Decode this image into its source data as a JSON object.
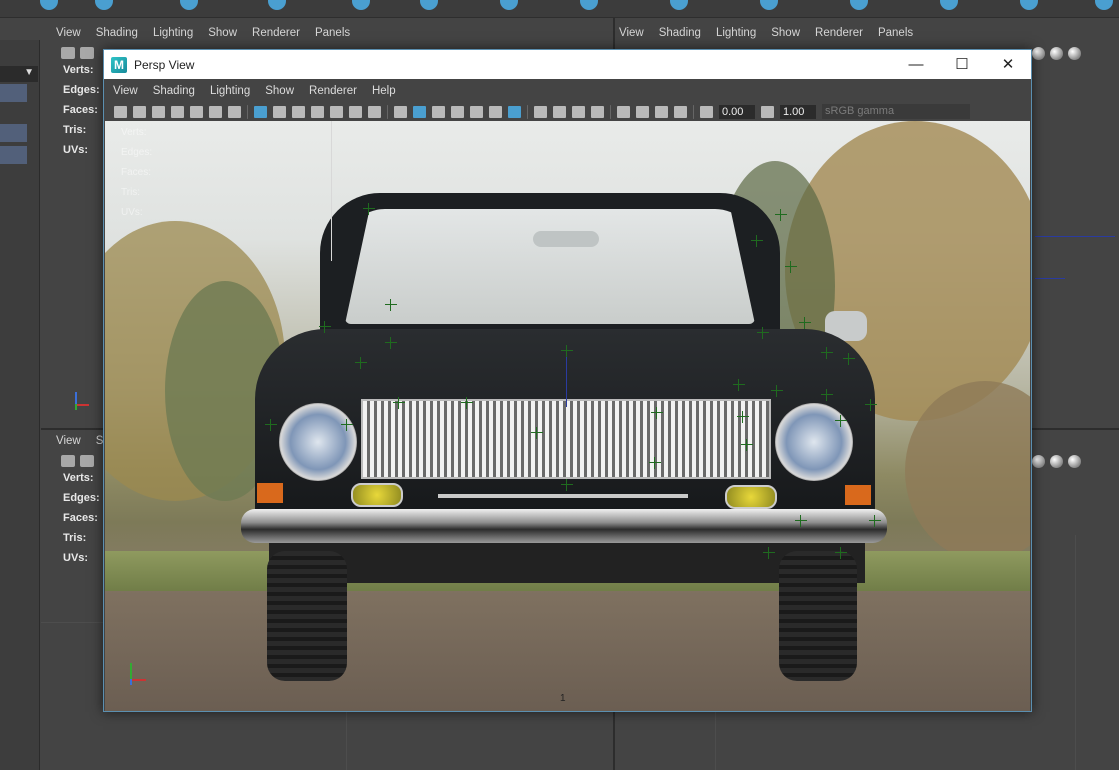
{
  "background_ui": {
    "top_pane_left": {
      "menu": [
        "View",
        "Shading",
        "Lighting",
        "Show",
        "Renderer",
        "Panels"
      ]
    },
    "top_pane_right": {
      "menu": [
        "View",
        "Shading",
        "Lighting",
        "Show",
        "Renderer",
        "Panels"
      ]
    },
    "bottom_pane_left": {
      "menu": [
        "View",
        "S"
      ]
    },
    "hud_labels": [
      "Verts:",
      "Edges:",
      "Faces:",
      "Tris:",
      "UVs:"
    ]
  },
  "window": {
    "title": "Persp View",
    "logo": "M",
    "minimize_glyph": "—",
    "maximize_glyph": "☐",
    "close_glyph": "✕"
  },
  "persp_panel": {
    "menu": [
      "View",
      "Shading",
      "Lighting",
      "Show",
      "Renderer",
      "Help"
    ],
    "exposure_value": "0.00",
    "gamma_value": "1.00",
    "color_space": "sRGB gamma",
    "hud_labels": [
      "Verts:",
      "Edges:",
      "Faces:",
      "Tris:",
      "UVs:"
    ],
    "frame_marker": "1"
  },
  "colors": {
    "accent": "#4a9fd0",
    "panel_bg": "#444444",
    "tracker_green": "#1f6b1f"
  }
}
